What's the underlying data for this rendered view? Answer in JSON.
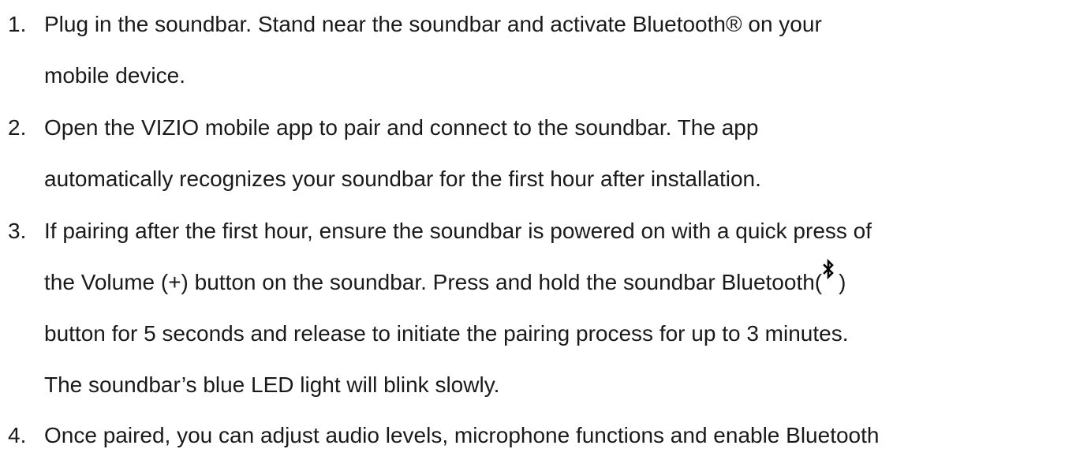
{
  "steps": [
    {
      "number": "1.",
      "lines": [
        "Plug in the soundbar. Stand near the soundbar and activate Bluetooth® on your",
        "mobile device."
      ]
    },
    {
      "number": "2.",
      "lines": [
        "Open the VIZIO mobile app to pair and connect to the soundbar. The app",
        "automatically recognizes your soundbar for the first hour after installation."
      ]
    },
    {
      "number": "3.",
      "lines": [
        "If pairing after the first hour, ensure the soundbar is powered on with a quick press of",
        "the Volume (+) button on the soundbar. Press and hold the soundbar Bluetooth(",
        ")",
        "button for 5 seconds and release to initiate the pairing process for up to 3 minutes.",
        "The soundbar’s blue LED light will blink slowly."
      ]
    },
    {
      "number": "4.",
      "lines": [
        "Once paired, you can adjust audio levels, microphone functions and enable Bluetooth"
      ]
    }
  ],
  "icons": {
    "bluetooth": "bluetooth-icon"
  }
}
